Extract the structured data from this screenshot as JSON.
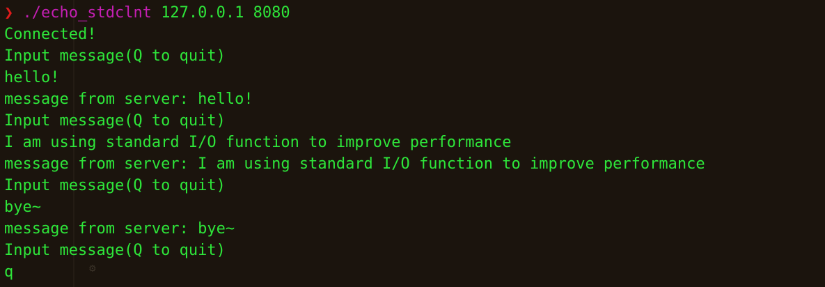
{
  "prompt": {
    "arrow": "❯",
    "command": "./echo_stdclnt",
    "args": "127.0.0.1 8080"
  },
  "output_lines": [
    "Connected!",
    "Input message(Q to quit)",
    "hello!",
    "message from server: hello!",
    "Input message(Q to quit)",
    "I am using standard I/O function to improve performance",
    "message from server: I am using standard I/O function to improve performance",
    "Input message(Q to quit)",
    "bye~",
    "message from server: bye~",
    "Input message(Q to quit)",
    "q"
  ],
  "ghost_icon": "⚙",
  "colors": {
    "background": "#1b140d",
    "text": "#2ee63a",
    "prompt_arrow": "#e01b1b",
    "command": "#c41fb3"
  }
}
